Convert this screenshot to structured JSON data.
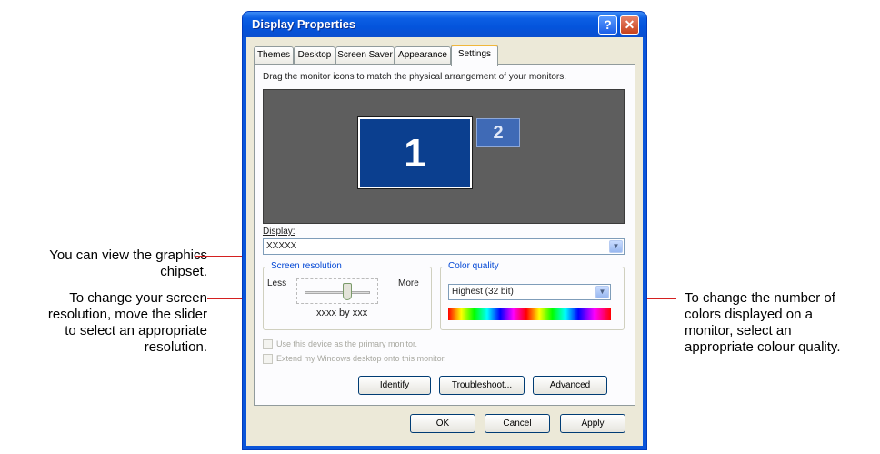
{
  "window": {
    "title": "Display Properties",
    "help_label": "?",
    "close_label": "✕"
  },
  "tabs": [
    {
      "label": "Themes"
    },
    {
      "label": "Desktop"
    },
    {
      "label": "Screen Saver"
    },
    {
      "label": "Appearance"
    },
    {
      "label": "Settings",
      "active": true
    }
  ],
  "settings": {
    "instruction": "Drag the monitor icons to match the physical arrangement of your monitors.",
    "monitor1": "1",
    "monitor2": "2",
    "display_label": "Display:",
    "display_value": "XXXXX",
    "resolution": {
      "group_title": "Screen resolution",
      "less": "Less",
      "more": "More",
      "value": "xxxx by xxx"
    },
    "color": {
      "group_title": "Color quality",
      "value": "Highest (32 bit)"
    },
    "check_primary": "Use this device as the primary monitor.",
    "check_extend": "Extend my Windows desktop onto this monitor.",
    "buttons": {
      "identify": "Identify",
      "troubleshoot": "Troubleshoot...",
      "advanced": "Advanced"
    }
  },
  "dialog_buttons": {
    "ok": "OK",
    "cancel": "Cancel",
    "apply": "Apply"
  },
  "callouts": {
    "chipset_line1": "You can view the graphics",
    "chipset_line2": "chipset.",
    "resolution_line1": "To change your screen",
    "resolution_line2": "resolution, move the slider",
    "resolution_line3": "to select an appropriate",
    "resolution_line4": "resolution.",
    "color_line1": "To change the number of",
    "color_line2": "colors displayed on a",
    "color_line3": "monitor, select an",
    "color_line4": "appropriate colour quality."
  },
  "colors": {
    "callout_line": "#d42020",
    "titlebar": "#0454dc",
    "monitor_primary": "#0b3f8f"
  }
}
